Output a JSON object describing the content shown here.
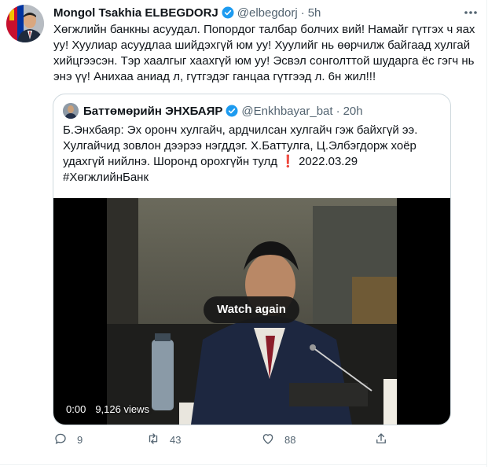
{
  "tweet": {
    "author_name": "Mongol Tsakhia ELBEGDORJ",
    "handle": "@elbegdorj",
    "separator": "·",
    "time": "5h",
    "text": "Хөгжлийн банкны асуудал. Попордог талбар болчих вий! Намайг гүтгэх ч яах уу! Хуулиар асуудлаа шийдэхгүй юм уу! Хуулийг нь өөрчилж байгаад хулгай хийцгээсэн. Тэр хаалгыг хаахгүй юм уу! Эсвэл сонголттой шударга ёс гэгч нь энэ үү! Анихаа аниад л, гүтгэдэг ганцаа гүтгээд л. 6н жил!!!",
    "counts": {
      "replies": "9",
      "retweets": "43",
      "likes": "88"
    }
  },
  "quote": {
    "author_name": "Баттөмөрийн ЭНХБАЯР",
    "handle": "@Enkhbayar_bat",
    "separator": "·",
    "time": "20h",
    "text_line1": "Б.Энхбаяр: Эх оронч хулгайч, ардчилсан хулгайч гэж байхгүй ээ. Хулгайчид зовлон дээрээ нэгддэг. Х.Баттулга, Ц.Элбэгдорж хоёр удахгүй нийлнэ. Шоронд орохгүйн тулд",
    "exclamation_emoji": "❗",
    "text_line2": "2022.03.29",
    "hashtag": "#ХөгжлийнБанк"
  },
  "video": {
    "watch_again_label": "Watch again",
    "timestamp": "0:00",
    "views": "9,126 views"
  },
  "icons": {
    "verified": "verified-badge-icon",
    "more": "more-icon",
    "reply": "reply-icon",
    "retweet": "retweet-icon",
    "like": "heart-icon",
    "share": "share-icon"
  },
  "colors": {
    "text": "#0f1419",
    "secondary": "#536471",
    "verified": "#1d9bf0",
    "border": "#cfd9de",
    "exclamation": "#e0245e"
  }
}
